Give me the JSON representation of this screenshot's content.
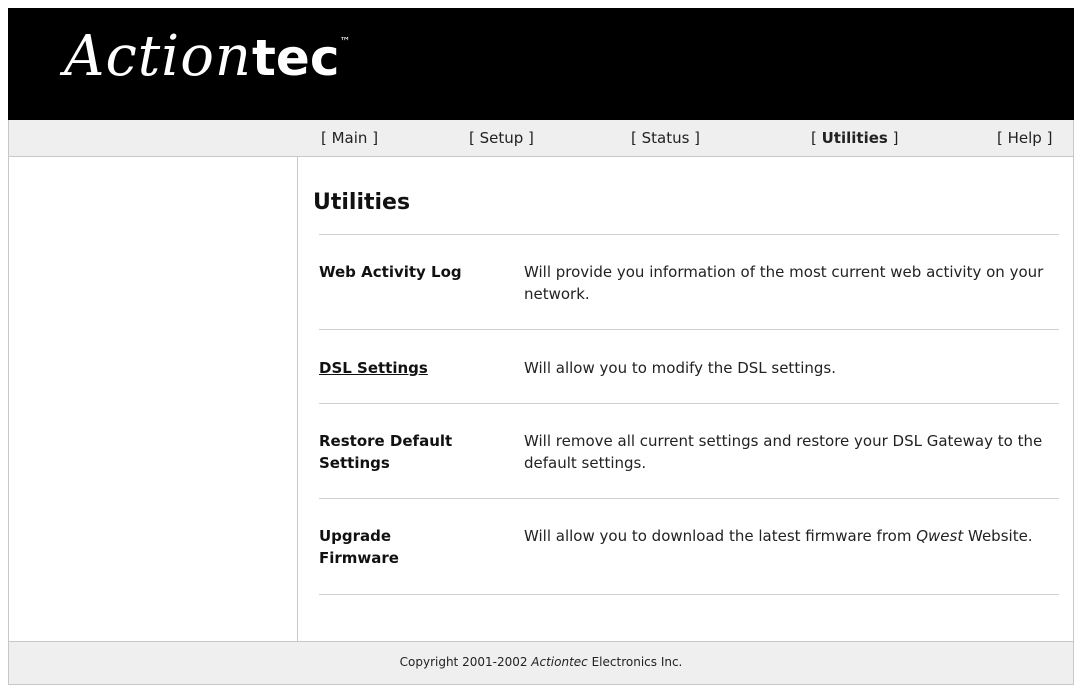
{
  "brand": {
    "logo_part1": "Action",
    "logo_part2": "tec",
    "trademark": "™"
  },
  "nav": {
    "main": "[ Main ]",
    "setup": "[ Setup ]",
    "status": "[ Status ]",
    "utilities_open": "[ ",
    "utilities": "Utilities",
    "utilities_close": " ]",
    "help": "[ Help ]",
    "active": "Utilities"
  },
  "page": {
    "title": "Utilities",
    "rows": [
      {
        "label": "Web Activity Log",
        "description": "Will provide you information of the most current web activity on your network."
      },
      {
        "label": "DSL Settings",
        "description": "Will allow you to modify the DSL settings."
      },
      {
        "label": "Restore Default Settings",
        "description": "Will remove all current settings and restore your DSL Gateway to the default settings."
      },
      {
        "label": "Upgrade Firmware",
        "description_pre": "Will allow you to download the latest firmware from ",
        "description_italic": "Qwest",
        "description_post": " Website."
      }
    ]
  },
  "footer": {
    "copyright_pre": "Copyright 2001-2002 ",
    "copyright_brand": "Actiontec",
    "copyright_post": " Electronics Inc."
  }
}
